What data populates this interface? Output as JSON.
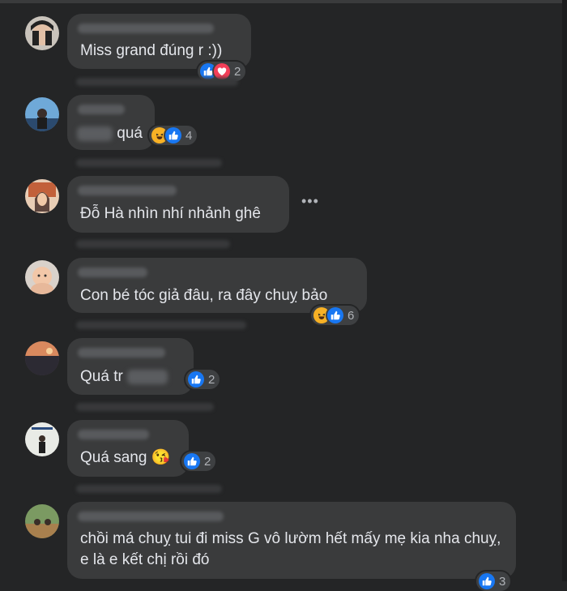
{
  "comments": [
    {
      "text": "Miss grand đúng r :))",
      "reaction_count": "2",
      "reactions": [
        "like",
        "love"
      ]
    },
    {
      "text": "quá",
      "reaction_count": "4",
      "reactions": [
        "haha",
        "like"
      ]
    },
    {
      "text": "Đỗ Hà nhìn nhí nhảnh ghê",
      "more": "•••"
    },
    {
      "text": "Con bé tóc giả đâu, ra đây chuỵ bảo",
      "reaction_count": "6",
      "reactions": [
        "haha",
        "like"
      ]
    },
    {
      "text": "Quá tr",
      "reaction_count": "2",
      "reactions": [
        "like"
      ]
    },
    {
      "text": "Quá sang",
      "emoji": "😘",
      "reaction_count": "2",
      "reactions": [
        "like"
      ]
    },
    {
      "text": "chồi má chuỵ tui đi miss G vô lườm hết mấy mẹ kia nha chuỵ, e là e kết chị rồi đó",
      "reaction_count": "3",
      "reactions": [
        "like"
      ]
    }
  ],
  "colors": {
    "background": "#242526",
    "bubble": "#3a3b3c",
    "text": "#e4e6eb",
    "like": "#1877f2",
    "love": "#f33e58",
    "haha": "#f7b125"
  }
}
